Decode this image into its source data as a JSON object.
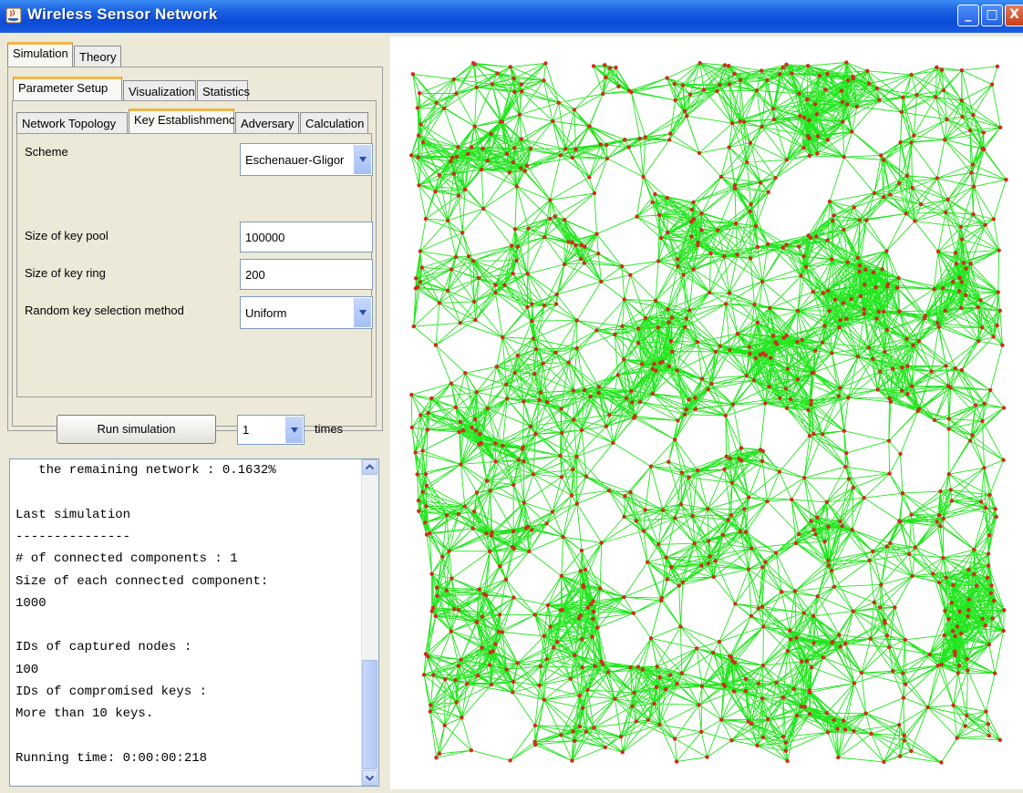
{
  "window": {
    "title": "Wireless Sensor Network",
    "minimize": "_",
    "maximize": "□",
    "close": "X"
  },
  "tabs_top": [
    "Simulation",
    "Theory"
  ],
  "tabs_mid": [
    "Parameter Setup",
    "Visualization",
    "Statistics"
  ],
  "tabs_sub": [
    "Network Topology",
    "Key Establishmenc",
    "Adversary",
    "Calculation"
  ],
  "form": {
    "scheme_label": "Scheme",
    "scheme_value": "Eschenauer-Gligor",
    "pool_label": "Size of key pool",
    "pool_value": "100000",
    "ring_label": "Size of key ring",
    "ring_value": "200",
    "method_label": "Random key selection method",
    "method_value": "Uniform"
  },
  "run": {
    "button": "Run simulation",
    "times_value": "1",
    "times_label": "times"
  },
  "output_lines": [
    "   the remaining network : 0.1632%",
    "",
    "Last simulation",
    "---------------",
    "# of connected components : 1",
    "Size of each connected component:",
    "1000",
    "",
    "IDs of captured nodes :",
    "100",
    "IDs of compromised keys :",
    "More than 10 keys.",
    "",
    "Running time: 0:00:00:218"
  ],
  "visualization": {
    "node_count": 1000,
    "node_color": "#d42a1e",
    "edge_color": "#22e61e"
  },
  "colors": {
    "title_bar": "#1a5fe0",
    "active_tab_accent": "#f0b64a"
  }
}
